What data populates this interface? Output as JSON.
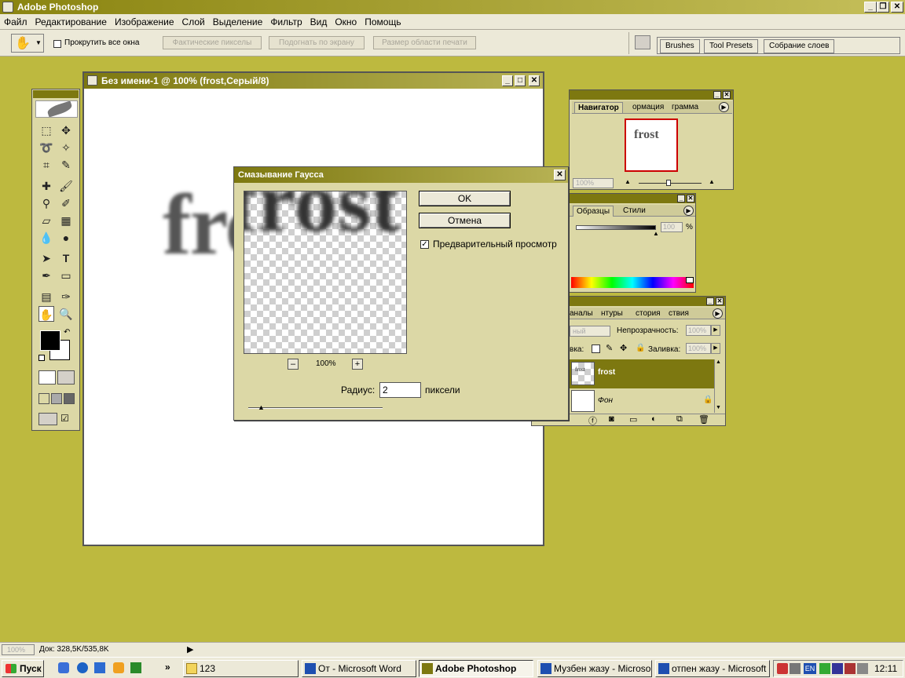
{
  "app": {
    "title": "Adobe Photoshop"
  },
  "menu": [
    "Файл",
    "Редактирование",
    "Изображение",
    "Слой",
    "Выделение",
    "Фильтр",
    "Вид",
    "Окно",
    "Помощь"
  ],
  "options": {
    "scroll_all_label": "Прокрутить все окна",
    "btn_actual": "Фактические пикселы",
    "btn_fit": "Подогнать по экрану",
    "btn_print": "Размер области печати"
  },
  "palette_well": [
    "Brushes",
    "Tool Presets",
    "Собрание слоев"
  ],
  "document": {
    "title": "Без имени-1 @ 100% (frost,Серый/8)",
    "text": "frost"
  },
  "navigator": {
    "tabs": [
      "Навигатор",
      "ормация",
      "грамма"
    ],
    "preview_text": "frost",
    "zoom": "100%"
  },
  "color_panel": {
    "tabs": [
      "Образцы",
      "Стили"
    ],
    "value": "100",
    "unit": "%"
  },
  "layers": {
    "tabs": [
      "аналы",
      "нтуры",
      "стория",
      "ствия"
    ],
    "blend": "ный",
    "opacity_label": "Непрозрачность:",
    "opacity": "100%",
    "lock_label": "вка:",
    "fill_label": "Заливка:",
    "fill": "100%",
    "items": [
      {
        "name": "frost",
        "thumb": "frost"
      },
      {
        "name": "Фон",
        "thumb": ""
      }
    ]
  },
  "dialog": {
    "title": "Смазывание Гаусса",
    "preview_text": "frost",
    "ok": "OK",
    "cancel": "Отмена",
    "preview_label": "Предварительный просмотр",
    "zoom": "100%",
    "zoom_minus": "–",
    "zoom_plus": "+",
    "radius_label": "Радиус:",
    "radius_value": "2",
    "radius_unit": "пиксели"
  },
  "status": {
    "zoom": "100%",
    "doc": "Док: 328,5K/535,8K"
  },
  "taskbar": {
    "start": "Пуск",
    "quick_more": "»",
    "items": [
      "123",
      "От - Microsoft Word",
      "Adobe Photoshop",
      "Музбен жазу - Microso...",
      "отпен жазу - Microsoft ..."
    ],
    "lang": "EN",
    "time": "12:11"
  },
  "colors": {
    "workspace": "#bdb93f",
    "title_active": "#7d7810",
    "selected_layer": "#7d7810"
  }
}
